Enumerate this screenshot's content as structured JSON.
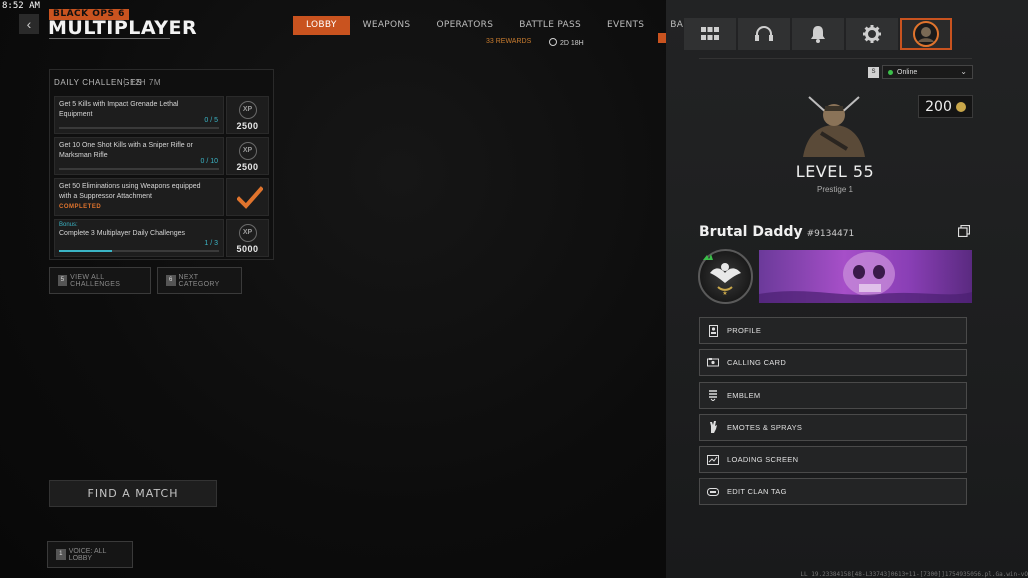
{
  "clock": "8:52 AM",
  "header": {
    "back_icon": "chevron-left-icon",
    "logo_sub": "BLACK OPS 6",
    "logo_main": "MULTIPLAYER"
  },
  "nav": {
    "tabs": [
      {
        "label": "LOBBY",
        "active": true
      },
      {
        "label": "WEAPONS",
        "active": false
      },
      {
        "label": "OPERATORS",
        "active": false
      },
      {
        "label": "BATTLE PASS",
        "active": false
      },
      {
        "label": "EVENTS",
        "active": false
      },
      {
        "label": "BARRACKS",
        "active": false
      }
    ],
    "battle_pass_sub": "33 REWARDS",
    "events_sub": "2D 18H"
  },
  "challenges": {
    "title": "DAILY CHALLENGES",
    "timer": "12H 7M",
    "items": [
      {
        "text": "Get 5 Kills with Impact Grenade Lethal Equipment",
        "progress": "0 / 5",
        "fill": 0.0,
        "xp_label": "XP",
        "reward": "2500"
      },
      {
        "text": "Get 10 One Shot Kills with a Sniper Rifle or Marksman Rifle",
        "progress": "0 / 10",
        "fill": 0.0,
        "xp_label": "XP",
        "reward": "2500"
      },
      {
        "text": "Get 50 Eliminations using Weapons equipped with a Suppressor Attachment",
        "status": "COMPLETED"
      },
      {
        "bonus_label": "Bonus:",
        "text": "Complete 3 Multiplayer Daily Challenges",
        "progress": "1 / 3",
        "fill": 0.333,
        "xp_label": "XP",
        "reward": "5000"
      }
    ],
    "view_all": {
      "key": "5",
      "label": "VIEW ALL CHALLENGES"
    },
    "next_category": {
      "key": "6",
      "label": "NEXT CATEGORY"
    }
  },
  "find_match": "FIND A MATCH",
  "voice": {
    "key": "1",
    "label": "VOICE: ALL LOBBY"
  },
  "side_tabs": [
    {
      "icon": "grid-icon"
    },
    {
      "icon": "headset-icon"
    },
    {
      "icon": "bell-icon"
    },
    {
      "icon": "gear-icon"
    },
    {
      "icon": "avatar-icon",
      "active": true
    }
  ],
  "status": {
    "key": "S",
    "label": "Online",
    "color": "#3bbf4a"
  },
  "currency": {
    "amount": "200",
    "icon": "cod-points-icon"
  },
  "player": {
    "level": "LEVEL 55",
    "prestige": "Prestige 1",
    "name": "Brutal Daddy",
    "tag": "#9134471"
  },
  "menu": [
    {
      "label": "PROFILE",
      "icon": "profile-icon"
    },
    {
      "label": "CALLING CARD",
      "icon": "calling-card-icon"
    },
    {
      "label": "EMBLEM",
      "icon": "emblem-icon"
    },
    {
      "label": "EMOTES & SPRAYS",
      "icon": "emote-icon"
    },
    {
      "label": "LOADING SCREEN",
      "icon": "loading-screen-icon"
    },
    {
      "label": "EDIT CLAN TAG",
      "icon": "clan-tag-icon"
    }
  ],
  "build": "LL 19.23384158[48-L33743]0613+11-[7300]]1754935056.pl.Ga.win-vO",
  "colors": {
    "accent": "#c9531f",
    "progress": "#3bb5c6",
    "complete": "#e0742d"
  }
}
